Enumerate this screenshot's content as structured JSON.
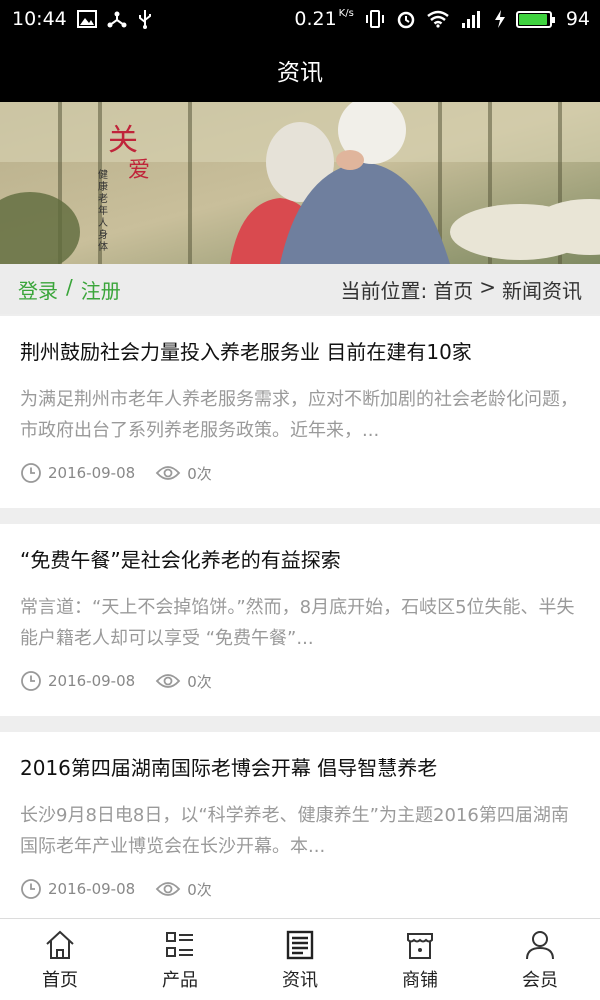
{
  "status_bar": {
    "time": "10:44",
    "net_speed": "0.21",
    "net_unit": "K/s",
    "battery": "94",
    "battery_level": 0.94,
    "battery_color": "#3fd23f"
  },
  "header": {
    "title": "资讯"
  },
  "banner": {
    "calligraphy_big": "关",
    "calligraphy_big2": "爱",
    "calligraphy_small": "健康老年人身体"
  },
  "crumb_bar": {
    "login": "登录",
    "separator": "/",
    "register": "注册",
    "location_label": "当前位置:",
    "home": "首页",
    "arrow": ">",
    "current": "新闻资讯",
    "accent_color": "#3aa53a"
  },
  "news": [
    {
      "title": "荆州鼓励社会力量投入养老服务业 目前在建有10家",
      "summary": "为满足荆州市老年人养老服务需求，应对不断加剧的社会老龄化问题，市政府出台了系列养老服务政策。近年来，...",
      "date": "2016-09-08",
      "views": "0次"
    },
    {
      "title": "“免费午餐”是社会化养老的有益探索",
      "summary": "常言道：“天上不会掉馅饼。”然而，8月底开始，石岐区5位失能、半失能户籍老人却可以享受 “免费午餐”...",
      "date": "2016-09-08",
      "views": "0次"
    },
    {
      "title": "2016第四届湖南国际老博会开幕 倡导智慧养老",
      "summary": "长沙9月8日电8日，以“科学养老、健康养生”为主题2016第四届湖南国际老年产业博览会在长沙开幕。本...",
      "date": "2016-09-08",
      "views": "0次"
    }
  ],
  "tabs": [
    {
      "label": "首页",
      "icon": "home-icon"
    },
    {
      "label": "产品",
      "icon": "list-icon"
    },
    {
      "label": "资讯",
      "icon": "news-icon"
    },
    {
      "label": "商铺",
      "icon": "store-icon"
    },
    {
      "label": "会员",
      "icon": "user-icon"
    }
  ]
}
